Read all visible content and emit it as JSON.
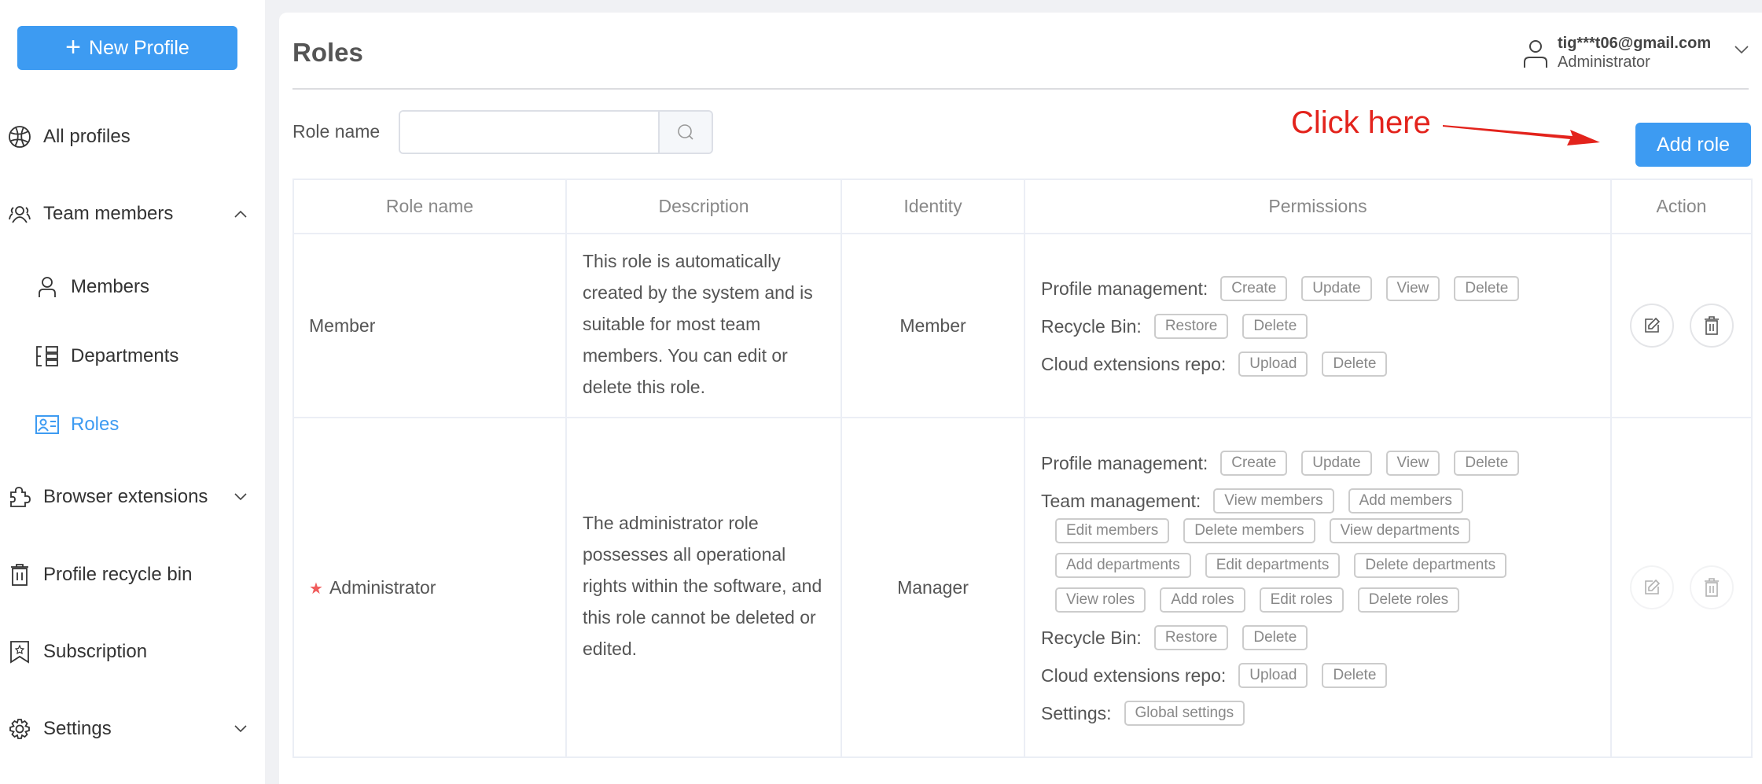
{
  "sidebar": {
    "new_profile_label": "New Profile",
    "items": [
      {
        "label": "All profiles",
        "icon": "globe-icon"
      },
      {
        "label": "Team members",
        "icon": "team-icon",
        "expanded": true
      },
      {
        "label": "Members",
        "icon": "user-icon"
      },
      {
        "label": "Departments",
        "icon": "departments-icon"
      },
      {
        "label": "Roles",
        "icon": "id-card-icon",
        "active": true
      },
      {
        "label": "Browser extensions",
        "icon": "puzzle-icon",
        "expanded": false
      },
      {
        "label": "Profile recycle bin",
        "icon": "trash-icon"
      },
      {
        "label": "Subscription",
        "icon": "bookmark-star-icon"
      },
      {
        "label": "Settings",
        "icon": "gear-icon",
        "expanded": false
      }
    ]
  },
  "header": {
    "title": "Roles",
    "user_email": "tig***t06@gmail.com",
    "user_role": "Administrator"
  },
  "search": {
    "label": "Role name",
    "value": "",
    "placeholder": ""
  },
  "annotation": {
    "text": "Click here"
  },
  "toolbar": {
    "add_role_label": "Add role"
  },
  "colors": {
    "accent": "#3d9bf2",
    "annotation": "#e3231c",
    "star": "#f05b5b"
  },
  "table": {
    "columns": [
      "Role name",
      "Description",
      "Identity",
      "Permissions",
      "Action"
    ],
    "rows": [
      {
        "name": "Member",
        "starred": false,
        "description": "This role is automatically created by the system and is suitable for most team members. You can edit or delete this role.",
        "identity": "Member",
        "permissions": [
          {
            "group": "Profile management:",
            "items": [
              "Create",
              "Update",
              "View",
              "Delete"
            ]
          },
          {
            "group": "Recycle Bin:",
            "items": [
              "Restore",
              "Delete"
            ]
          },
          {
            "group": "Cloud extensions repo:",
            "items": [
              "Upload",
              "Delete"
            ]
          }
        ],
        "actions_enabled": true
      },
      {
        "name": "Administrator",
        "starred": true,
        "description": "The administrator role possesses all operational rights within the software, and this role cannot be deleted or edited.",
        "identity": "Manager",
        "permissions": [
          {
            "group": "Profile management:",
            "items": [
              "Create",
              "Update",
              "View",
              "Delete"
            ]
          },
          {
            "group": "Team management:",
            "items": [
              "View members",
              "Add members"
            ],
            "wrapped_items": [
              "Edit members",
              "Delete members",
              "View departments",
              "Add departments",
              "Edit departments",
              "Delete departments",
              "View roles",
              "Add roles",
              "Edit roles",
              "Delete roles"
            ]
          },
          {
            "group": "Recycle Bin:",
            "items": [
              "Restore",
              "Delete"
            ]
          },
          {
            "group": "Cloud extensions repo:",
            "items": [
              "Upload",
              "Delete"
            ]
          },
          {
            "group": "Settings:",
            "items": [
              "Global settings"
            ]
          }
        ],
        "actions_enabled": false
      }
    ]
  }
}
